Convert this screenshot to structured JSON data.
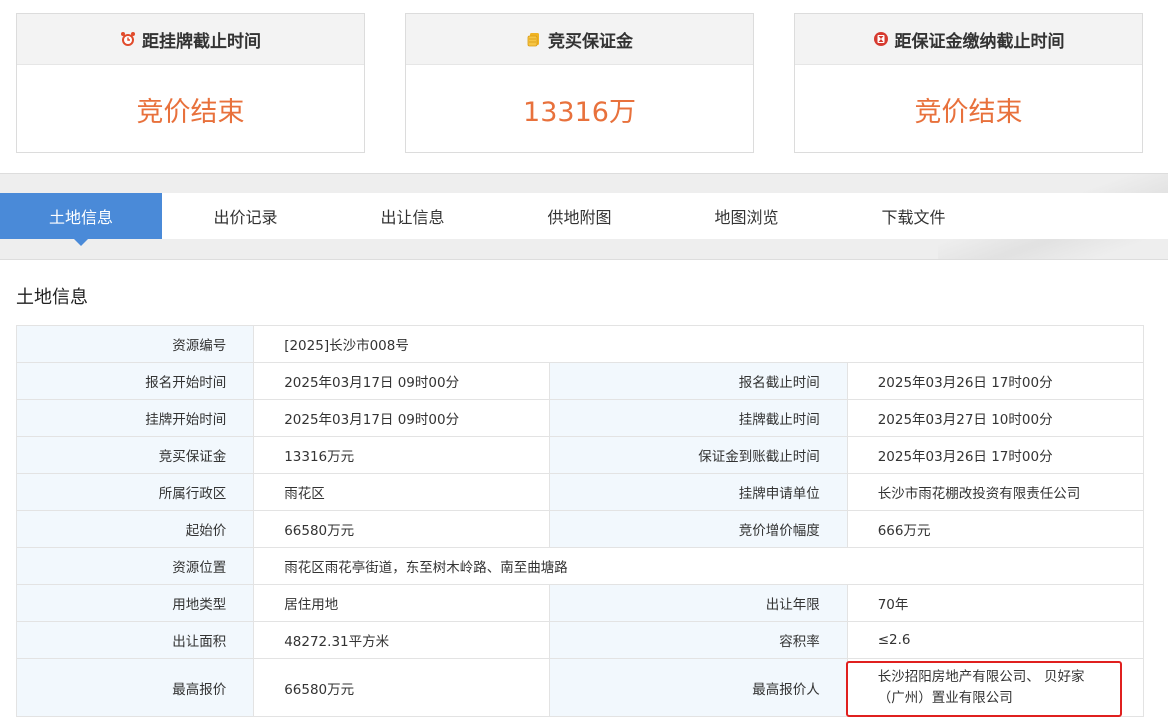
{
  "cards": [
    {
      "title": "距挂牌截止时间",
      "value": "竞价结束",
      "icon": "alarm-clock-icon"
    },
    {
      "title": "竞买保证金",
      "value": "13316万",
      "icon": "coin-stack-icon"
    },
    {
      "title": "距保证金缴纳截止时间",
      "value": "竞价结束",
      "icon": "timer-icon"
    }
  ],
  "tabs": [
    "土地信息",
    "出价记录",
    "出让信息",
    "供地附图",
    "地图浏览",
    "下载文件"
  ],
  "active_tab": 0,
  "section_title": "土地信息",
  "rows": [
    {
      "l1": "资源编号",
      "v1": "[2025]长沙市008号"
    },
    {
      "l1": "报名开始时间",
      "v1": "2025年03月17日 09时00分",
      "l2": "报名截止时间",
      "v2": "2025年03月26日 17时00分"
    },
    {
      "l1": "挂牌开始时间",
      "v1": "2025年03月17日 09时00分",
      "l2": "挂牌截止时间",
      "v2": "2025年03月27日 10时00分"
    },
    {
      "l1": "竞买保证金",
      "v1": "13316万元",
      "l2": "保证金到账截止时间",
      "v2": "2025年03月26日 17时00分"
    },
    {
      "l1": "所属行政区",
      "v1": "雨花区",
      "l2": "挂牌申请单位",
      "v2": "长沙市雨花棚改投资有限责任公司"
    },
    {
      "l1": "起始价",
      "v1": "66580万元",
      "l2": "竞价增价幅度",
      "v2": "666万元"
    },
    {
      "l1": "资源位置",
      "v1": "雨花区雨花亭街道，东至树木岭路、南至曲塘路"
    },
    {
      "l1": "用地类型",
      "v1": "居住用地",
      "l2": "出让年限",
      "v2": "70年"
    },
    {
      "l1": "出让面积",
      "v1": "48272.31平方米",
      "l2": "容积率",
      "v2": "≤2.6"
    },
    {
      "l1": "最高报价",
      "v1": "66580万元",
      "l2": "最高报价人",
      "v2_line1": "长沙招阳房地产有限公司、 贝好家",
      "v2_line2": "（广州）置业有限公司"
    }
  ],
  "colors": {
    "accent": "#4a8ad8",
    "value_orange": "#e8713c",
    "highlight_red": "#e0201f",
    "label_bg": "#f2f8fd"
  }
}
